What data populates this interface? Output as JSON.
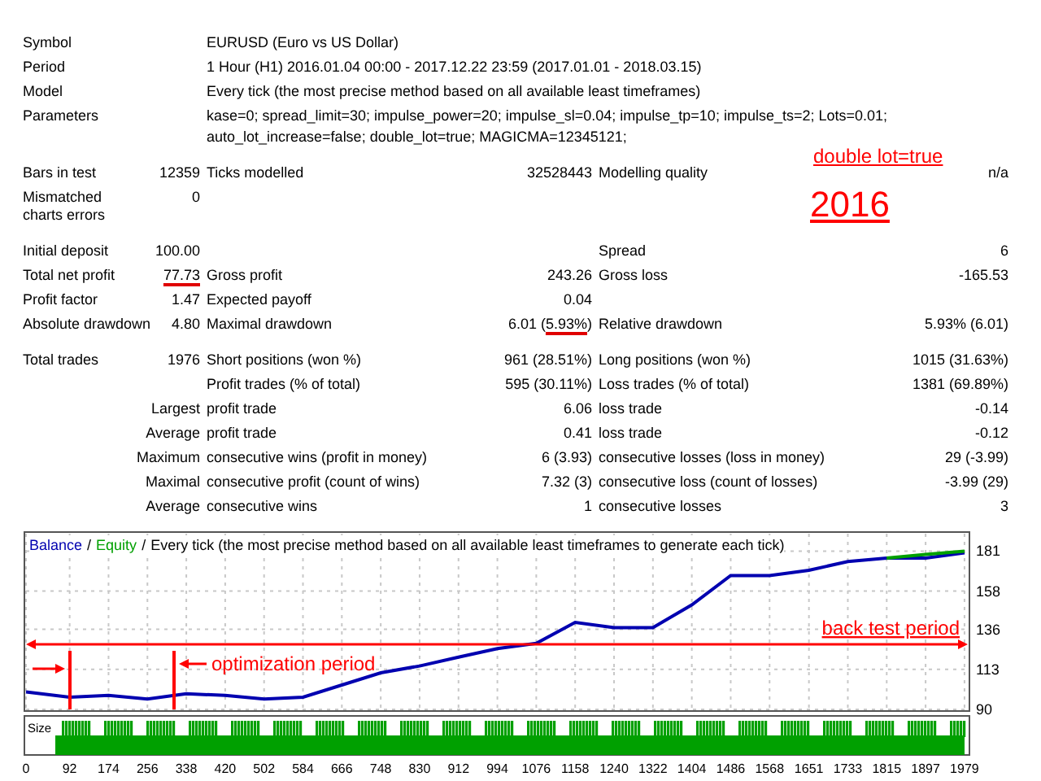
{
  "report": {
    "sections": [
      [
        {
          "kind": "wide",
          "label": "Symbol",
          "value": "EURUSD (Euro vs US Dollar)"
        },
        {
          "kind": "wide",
          "label": "Period",
          "value": "1 Hour (H1) 2016.01.04 00:00 - 2017.12.22 23:59 (2017.01.01 - 2018.03.15)"
        },
        {
          "kind": "wide",
          "label": "Model",
          "value": "Every tick (the most precise method based on all available least timeframes)"
        },
        {
          "kind": "wide",
          "label": "Parameters",
          "value": "kase=0; spread_limit=30; impulse_power=20; impulse_sl=0.04; impulse_tp=10; impulse_ts=2; Lots=0.01; auto_lot_increase=false; double_lot=true; MAGICMA=12345121;"
        }
      ],
      [
        {
          "kind": "triple",
          "label": "Bars in test",
          "value": "12359",
          "label2": "Ticks modelled",
          "value2": "32528443",
          "label3": "Modelling quality",
          "value3": "n/a"
        },
        {
          "kind": "triple",
          "label": "Mismatched charts errors",
          "value": "0"
        }
      ],
      [
        {
          "kind": "triple",
          "label": "Initial deposit",
          "value": "100.00",
          "label3": "Spread",
          "value3": "6"
        },
        {
          "kind": "triple",
          "label": "Total net profit",
          "value": [
            {
              "text": "77.73",
              "underlined": true
            }
          ],
          "label2": "Gross profit",
          "value2": "243.26",
          "label3": "Gross loss",
          "value3": "-165.53"
        },
        {
          "kind": "triple",
          "label": "Profit factor",
          "value": "1.47",
          "label2": "Expected payoff",
          "value2": "0.04"
        },
        {
          "kind": "triple",
          "label": "Absolute drawdown",
          "value": "4.80",
          "label2": "Maximal drawdown",
          "value2": [
            {
              "text": "6.01 ("
            },
            {
              "text": "5.93%",
              "underlined": true
            },
            {
              "text": ")"
            }
          ],
          "label3": "Relative drawdown",
          "value3": "5.93% (6.01)"
        }
      ],
      [
        {
          "kind": "triple",
          "label": "Total trades",
          "value": "1976",
          "label2": "Short positions (won %)",
          "value2": "961 (28.51%)",
          "label3": "Long positions (won %)",
          "value3": "1015 (31.63%)"
        },
        {
          "kind": "sub",
          "label2": "Profit trades (% of total)",
          "value2": "595 (30.11%)",
          "label3": "Loss trades (% of total)",
          "value3": "1381 (69.89%)"
        },
        {
          "kind": "sub",
          "group": "Largest",
          "label2": "profit trade",
          "value2": "6.06",
          "label3": "loss trade",
          "value3": "-0.14"
        },
        {
          "kind": "sub",
          "group": "Average",
          "label2": "profit trade",
          "value2": "0.41",
          "label3": "loss trade",
          "value3": "-0.12"
        },
        {
          "kind": "sub",
          "group": "Maximum",
          "label2": "consecutive wins (profit in money)",
          "value2": "6 (3.93)",
          "label3": "consecutive losses (loss in money)",
          "value3": "29 (-3.99)"
        },
        {
          "kind": "sub",
          "group": "Maximal",
          "label2": "consecutive profit (count of wins)",
          "value2": "7.32 (3)",
          "label3": "consecutive loss (count of losses)",
          "value3": "-3.99 (29)"
        },
        {
          "kind": "sub",
          "group": "Average",
          "label2": "consecutive wins",
          "value2": "1",
          "label3": "consecutive losses",
          "value3": "3"
        }
      ]
    ],
    "notes": [
      {
        "kind": "callout",
        "text": "double lot=true"
      },
      {
        "kind": "year",
        "text": "2016"
      }
    ]
  },
  "chart": {
    "legend_separators": [
      "/",
      "/"
    ],
    "chart_data": {
      "type": "line",
      "title": "Every tick (the most precise method based on all available least timeframes to generate each tick)",
      "x": [
        0,
        92,
        174,
        256,
        338,
        420,
        502,
        584,
        666,
        748,
        830,
        912,
        994,
        1076,
        1158,
        1240,
        1322,
        1404,
        1486,
        1568,
        1651,
        1733,
        1815,
        1897,
        1979
      ],
      "series": [
        {
          "name": "Balance",
          "color": "#0000b0",
          "values": [
            100,
            97,
            98,
            96,
            99,
            98,
            96,
            97,
            104,
            111,
            115,
            120,
            125,
            128,
            140,
            137,
            137,
            150,
            167,
            167,
            170,
            175,
            177,
            177,
            180
          ]
        },
        {
          "name": "Equity",
          "color": "#00a000",
          "values": [
            null,
            null,
            null,
            null,
            null,
            null,
            null,
            null,
            null,
            null,
            null,
            null,
            null,
            null,
            null,
            null,
            null,
            null,
            null,
            null,
            null,
            null,
            177,
            179,
            181
          ]
        }
      ],
      "xlim": [
        0,
        1986
      ],
      "ylim": [
        90,
        191
      ],
      "xticks": [
        0,
        92,
        174,
        256,
        338,
        420,
        502,
        584,
        666,
        748,
        830,
        912,
        994,
        1076,
        1158,
        1240,
        1322,
        1404,
        1486,
        1568,
        1651,
        1733,
        1815,
        1897,
        1979
      ],
      "yticks": [
        90,
        113,
        136,
        158,
        181
      ],
      "grid": true,
      "annotations": [
        "back test period",
        "optimization period"
      ]
    },
    "volume_panel": {
      "label": "Size"
    }
  }
}
